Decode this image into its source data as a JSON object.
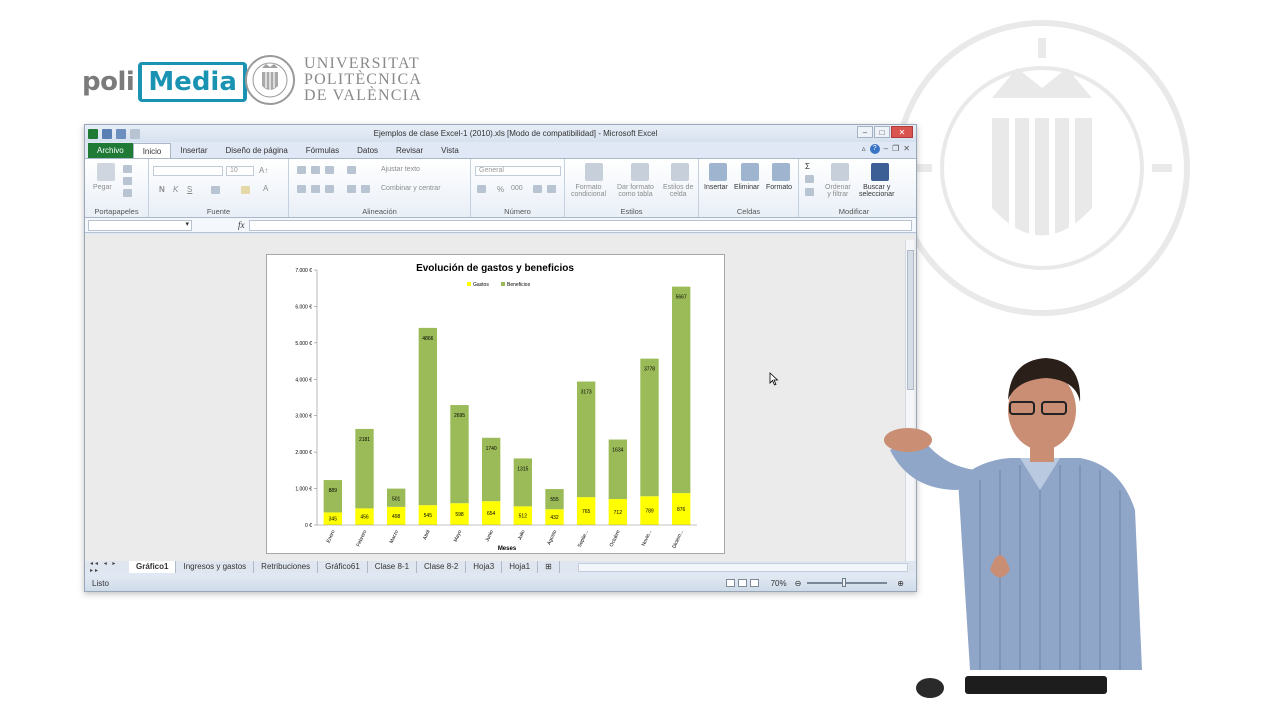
{
  "branding": {
    "poli": "poli",
    "media": "Media",
    "university_lines": [
      "UNIVERSITAT",
      "POLITÈCNICA",
      "DE VALÈNCIA"
    ]
  },
  "excel": {
    "title": "Ejemplos de clase Excel-1 (2010).xls  [Modo de compatibilidad]  -  Microsoft Excel",
    "tabs": [
      "Archivo",
      "Inicio",
      "Insertar",
      "Diseño de página",
      "Fórmulas",
      "Datos",
      "Revisar",
      "Vista"
    ],
    "active_tab": "Inicio",
    "ribbon": {
      "portapapeles": {
        "label": "Portapapeles",
        "paste": "Pegar"
      },
      "fuente": {
        "label": "Fuente",
        "size": "10",
        "bold": "N",
        "italic": "K",
        "underline": "S"
      },
      "alineacion": {
        "label": "Alineación",
        "wrap": "Ajustar texto",
        "merge": "Combinar y centrar"
      },
      "numero": {
        "label": "Número",
        "format": "General",
        "percent": "%",
        "thousands": "000"
      },
      "estilos": {
        "label": "Estilos",
        "conditional": [
          "Formato",
          "condicional"
        ],
        "table": [
          "Dar formato",
          "como tabla"
        ],
        "cell": [
          "Estilos de",
          "celda"
        ]
      },
      "celdas": {
        "label": "Celdas",
        "insert": "Insertar",
        "delete": "Eliminar",
        "format": "Formato"
      },
      "modificar": {
        "label": "Modificar",
        "sort": [
          "Ordenar",
          "y filtrar"
        ],
        "find": [
          "Buscar y",
          "seleccionar"
        ]
      }
    },
    "formula_bar": {
      "fx": "fx"
    },
    "sheet_tabs": [
      "Gráfico1",
      "Ingresos y gastos",
      "Retribuciones",
      "Gráfico61",
      "Clase 8-1",
      "Clase 8-2",
      "Hoja3",
      "Hoja1"
    ],
    "active_sheet": "Gráfico1",
    "status": {
      "ready": "Listo",
      "zoom": "70%",
      "zoom_fraction": 0.44
    }
  },
  "chart_data": {
    "type": "bar",
    "stacked": true,
    "title": "Evolución de gastos y beneficios",
    "xlabel": "Meses",
    "ylabel": "",
    "ylim": [
      0,
      7000
    ],
    "yticks": [
      "0 €",
      "1.000 €",
      "2.000 €",
      "3.000 €",
      "4.000 €",
      "5.000 €",
      "6.000 €",
      "7.000 €"
    ],
    "tick_values": [
      0,
      1000,
      2000,
      3000,
      4000,
      5000,
      6000,
      7000
    ],
    "categories": [
      "Enero",
      "Febrero",
      "Marzo",
      "Abril",
      "Mayo",
      "Junio",
      "Julio",
      "Agosto",
      "Septie...",
      "Octubre",
      "Novie...",
      "Diciem..."
    ],
    "legend_position": "top",
    "series": [
      {
        "name": "Gastos",
        "color": "#ffff00",
        "values": [
          345,
          456,
          498,
          545,
          598,
          654,
          512,
          432,
          765,
          712,
          789,
          876
        ]
      },
      {
        "name": "Beneficios",
        "color": "#9bbb59",
        "values": [
          889,
          2181,
          501,
          4866,
          2695,
          1740,
          1315,
          555,
          3173,
          1634,
          3778,
          5667
        ]
      }
    ]
  }
}
